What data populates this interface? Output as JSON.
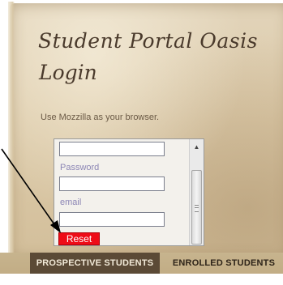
{
  "site": {
    "title": "Student Portal Oasis",
    "subtitle": "Login"
  },
  "login": {
    "hint": "Use Mozzilla as your browser.",
    "username_value": "",
    "password_label": "Password",
    "password_value": "",
    "email_label": "email",
    "email_value": "",
    "reset_label": "Reset",
    "scroll_up_glyph": "▲"
  },
  "nav": {
    "tabs": [
      {
        "label": "PROSPECTIVE STUDENTS",
        "active": true
      },
      {
        "label": "ENROLLED STUDENTS",
        "active": false
      }
    ]
  },
  "colors": {
    "parchment": "#dccaa9",
    "heading": "#4a3a2c",
    "reset_button": "#ee0c17",
    "active_tab": "#5b4a36",
    "nav_bar": "#c7b48e"
  }
}
